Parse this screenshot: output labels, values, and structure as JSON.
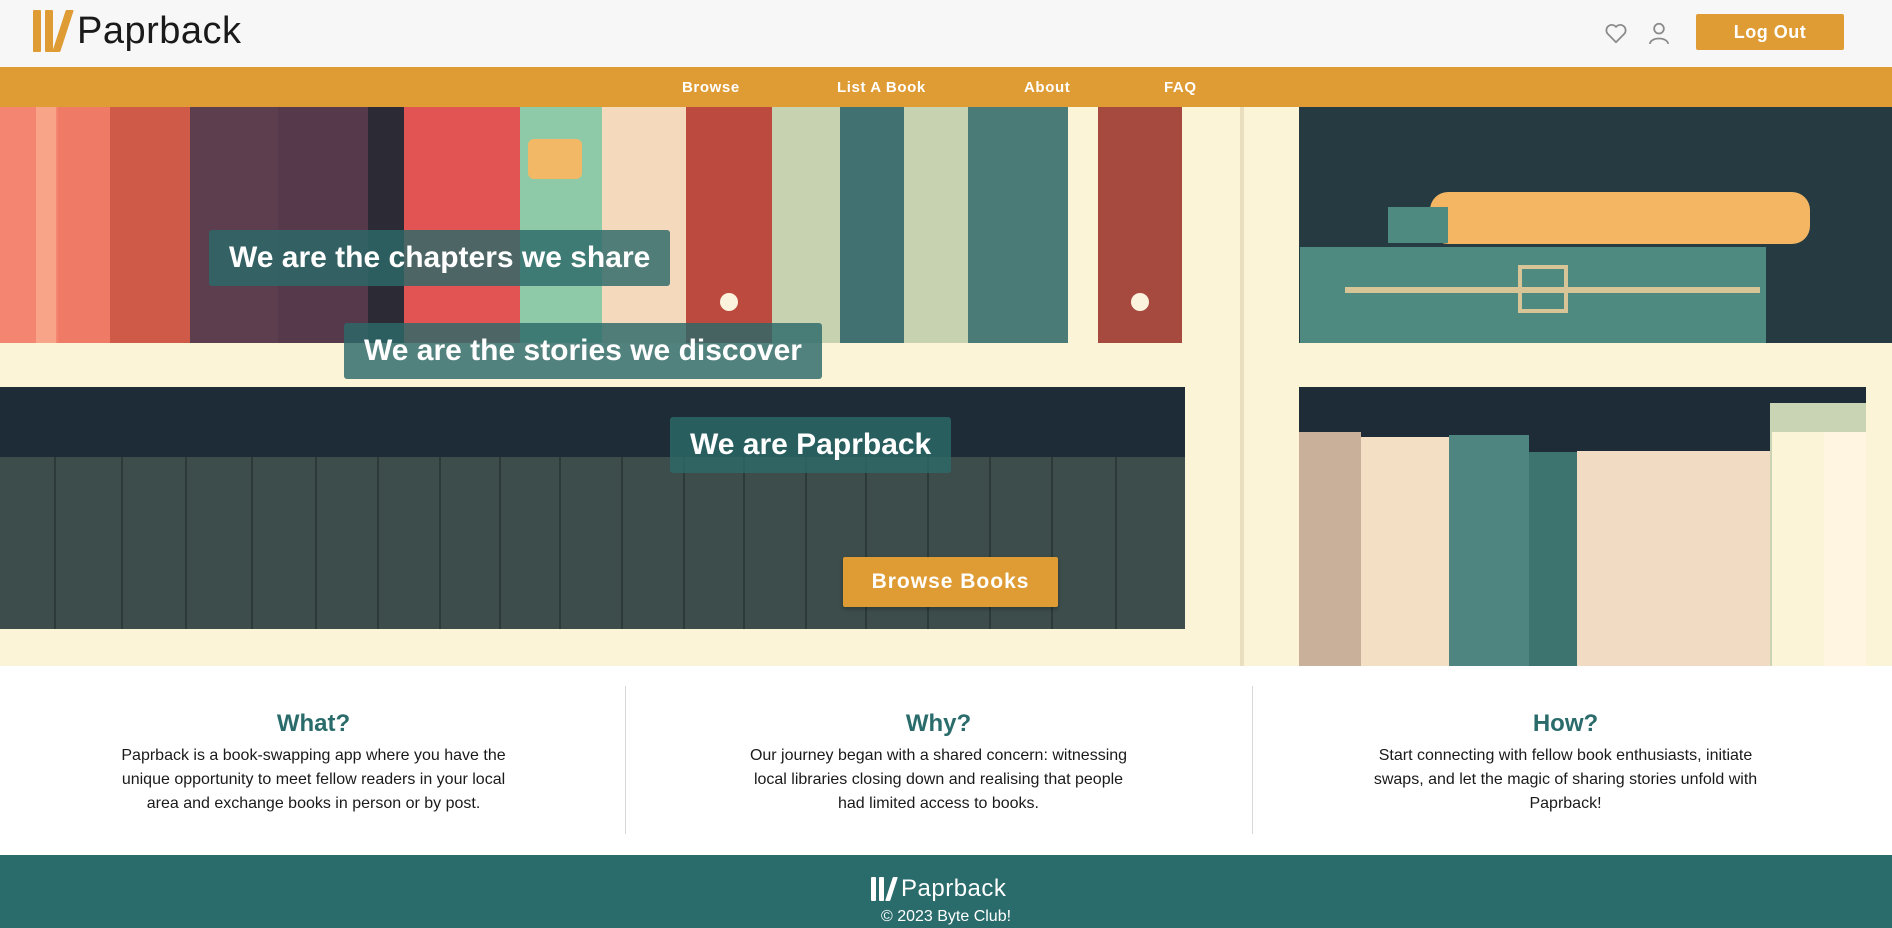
{
  "header": {
    "logo_text": "Paprback",
    "wishlist_icon": "heart-icon",
    "account_icon": "user-icon",
    "logout_label": "Log Out"
  },
  "nav": {
    "items": [
      {
        "label": "Browse"
      },
      {
        "label": "List A Book"
      },
      {
        "label": "About"
      },
      {
        "label": "FAQ"
      }
    ]
  },
  "hero": {
    "taglines": [
      "We are the chapters we share",
      "We are the stories we discover",
      "We are Paprback"
    ],
    "cta_label": "Browse Books"
  },
  "info": {
    "columns": [
      {
        "title": "What?",
        "text": "Paprback is a book-swapping app where you have the unique opportunity to meet fellow readers in your local area and exchange books in person or by post."
      },
      {
        "title": "Why?",
        "text": "Our journey began with a shared concern: witnessing local libraries closing down and realising that people had limited access to books."
      },
      {
        "title": "How?",
        "text": "Start connecting with fellow book enthusiasts, initiate swaps, and let the magic of sharing stories unfold with Paprback!"
      }
    ]
  },
  "footer": {
    "logo_text": "Paprback",
    "copyright": "© 2023 Byte Club!"
  },
  "colors": {
    "brand_orange": "#df9c34",
    "brand_teal": "#2a6b6b",
    "header_bg": "#f7f7f7"
  }
}
